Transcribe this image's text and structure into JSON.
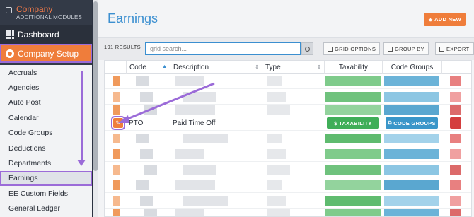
{
  "sidebar": {
    "company_name": "Company",
    "company_sub": "ADDITIONAL MODULES",
    "dashboard": "Dashboard",
    "company_setup": "Company Setup",
    "items": [
      "Accruals",
      "Agencies",
      "Auto Post",
      "Calendar",
      "Code Groups",
      "Deductions",
      "Departments",
      "Earnings",
      "EE Custom Fields",
      "General Ledger"
    ],
    "active_item": "Earnings"
  },
  "page": {
    "title": "Earnings",
    "add_new": "ADD NEW"
  },
  "toolbar": {
    "results": "191 RESULTS",
    "search_placeholder": "grid search...",
    "grid_options": "GRID OPTIONS",
    "group_by": "GROUP BY",
    "export": "EXPORT"
  },
  "grid": {
    "columns": [
      "Code",
      "Description",
      "Type",
      "Taxability",
      "Code Groups"
    ],
    "highlight_row": {
      "code": "PTO",
      "description": "Paid Time Off",
      "type": "",
      "taxability_button": "$ TAXABILITY",
      "code_groups_button": "CODE GROUPS"
    }
  },
  "colors": {
    "accent": "#ef7d3b",
    "title": "#3b8fd0",
    "annotation": "#9b6bd8",
    "taxability": "#3fae58",
    "code_groups": "#3a96c9",
    "delete": "#d43d3d"
  }
}
